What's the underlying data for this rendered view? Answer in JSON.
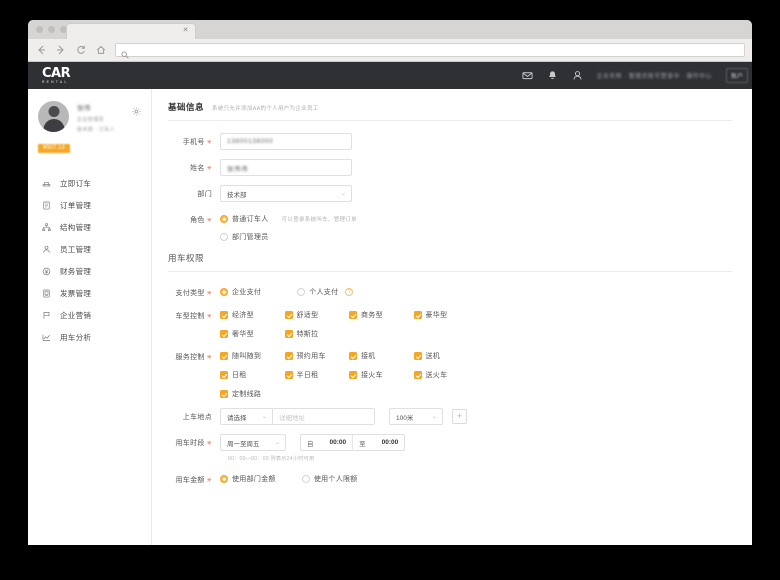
{
  "browser": {
    "tab_title": "",
    "back_icon": "back-arrow-icon",
    "forward_icon": "forward-arrow-icon",
    "reload_icon": "reload-icon",
    "home_icon": "home-icon",
    "address_placeholder": "",
    "search_icon": "search-icon"
  },
  "topbar": {
    "logo_main": "CAR",
    "logo_sub": "RENTAL",
    "mail_icon": "mail-icon",
    "bell_icon": "bell-icon",
    "user_icon": "user-icon",
    "account_text": "企业名称 · 管理员账号登录中 · 操作中心",
    "action_button": "账户"
  },
  "sidebar": {
    "profile": {
      "name": "张伟",
      "line1": "企业管理员",
      "line2": "技术部 · 订车人",
      "balance_badge": "¥507.13",
      "gear_icon": "gear-icon",
      "avatar": "avatar"
    },
    "items": [
      {
        "label": "立即订车",
        "icon": "car-icon"
      },
      {
        "label": "订单管理",
        "icon": "list-icon"
      },
      {
        "label": "结构管理",
        "icon": "org-tree-icon"
      },
      {
        "label": "员工管理",
        "icon": "person-icon"
      },
      {
        "label": "财务管理",
        "icon": "money-icon"
      },
      {
        "label": "发票管理",
        "icon": "invoice-icon"
      },
      {
        "label": "企业营销",
        "icon": "flag-icon"
      },
      {
        "label": "用车分析",
        "icon": "chart-icon"
      }
    ]
  },
  "content": {
    "basic": {
      "title": "基础信息",
      "subtitle": "系统只允许添加AA的个人用户为企业员工",
      "phone_label": "手机号",
      "phone_value": "13800138000",
      "name_label": "姓名",
      "name_value": "张伟伟",
      "dept_label": "部门",
      "dept_value": "技术部",
      "role_label": "角色",
      "role_options": [
        {
          "label": "普通订车人",
          "selected": true,
          "hint": "可以登录系统叫车、管理订单"
        },
        {
          "label": "部门管理员",
          "selected": false,
          "hint": ""
        }
      ]
    },
    "permission": {
      "title": "用车权限",
      "pay_label": "支付类型",
      "pay_options": [
        {
          "label": "企业支付",
          "selected": true
        },
        {
          "label": "个人支付",
          "selected": false
        }
      ],
      "pay_help_icon": "question-icon",
      "car_label": "车型控制",
      "car_options": [
        {
          "label": "经济型",
          "checked": true
        },
        {
          "label": "舒适型",
          "checked": true
        },
        {
          "label": "商务型",
          "checked": true
        },
        {
          "label": "豪华型",
          "checked": true
        },
        {
          "label": "奢华型",
          "checked": true
        },
        {
          "label": "特斯拉",
          "checked": true
        }
      ],
      "service_label": "服务控制",
      "service_options": [
        {
          "label": "随叫随到",
          "checked": true
        },
        {
          "label": "预约用车",
          "checked": true
        },
        {
          "label": "接机",
          "checked": true
        },
        {
          "label": "送机",
          "checked": true
        },
        {
          "label": "日租",
          "checked": true
        },
        {
          "label": "半日租",
          "checked": true
        },
        {
          "label": "接火车",
          "checked": true
        },
        {
          "label": "送火车",
          "checked": true
        },
        {
          "label": "定制线路",
          "checked": true
        }
      ],
      "location_label": "上车地点",
      "location_select": "请选择",
      "location_placeholder": "详细地址",
      "location_value": "",
      "radius_select": "100米",
      "add_icon": "plus-icon",
      "period_label": "用车时段",
      "period_select": "周一至周五",
      "time_from_prefix": "自",
      "time_from": "00:00",
      "time_to_prefix": "至",
      "time_to": "00:00",
      "period_hint": "00：00—00：00 则表示24小时可用",
      "amount_label": "用车金额",
      "amount_options": [
        {
          "label": "使用部门金额",
          "selected": true
        },
        {
          "label": "使用个人限额",
          "selected": false
        }
      ]
    }
  },
  "colors": {
    "accent": "#f5a623",
    "topbar": "#2e3033",
    "required": "#e8603c"
  }
}
